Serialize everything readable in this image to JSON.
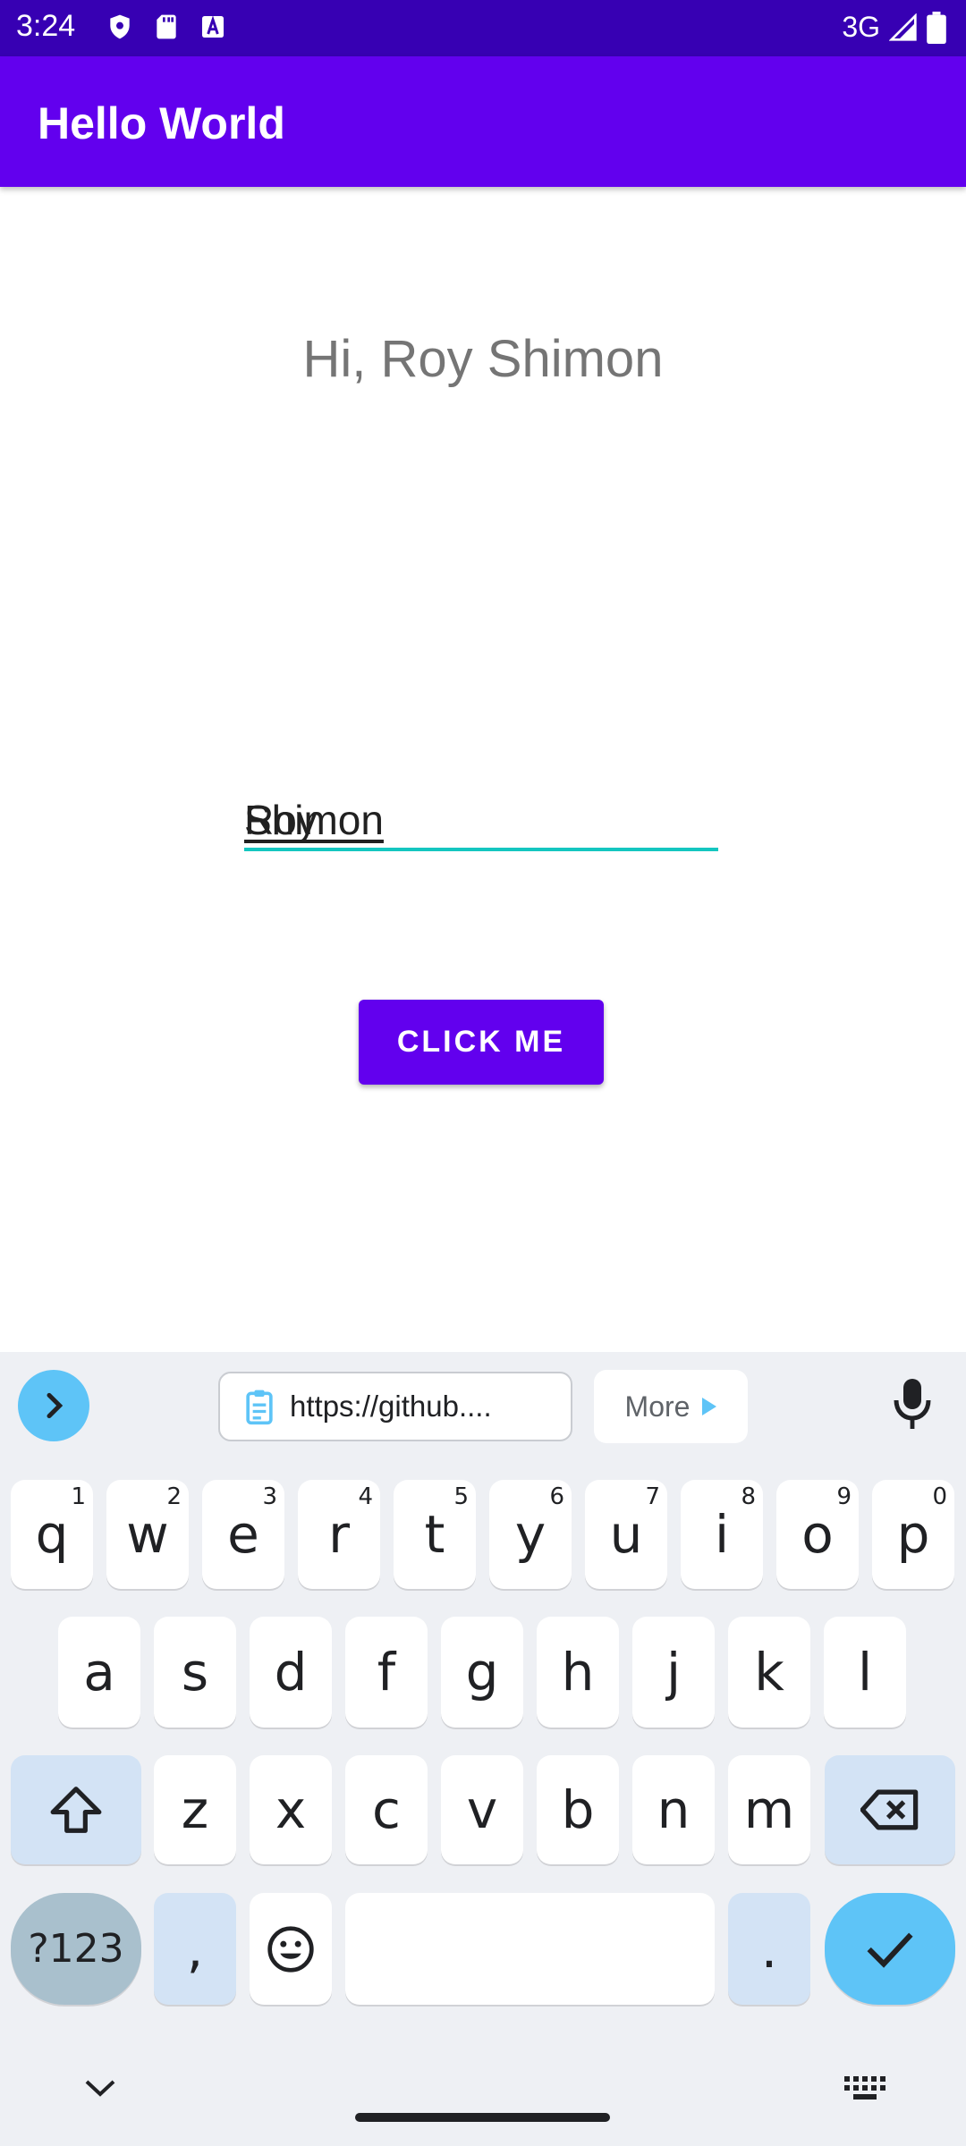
{
  "status_bar": {
    "time": "3:24",
    "network": "3G",
    "icons_left": [
      "shield-icon",
      "sd-card-icon",
      "text-a-icon"
    ],
    "icons_right": [
      "signal-icon",
      "battery-icon"
    ]
  },
  "app_bar": {
    "title": "Hello World"
  },
  "main": {
    "greeting": "Hi, Roy Shimon",
    "name_input": {
      "first": "Roy",
      "second": "Shimon"
    },
    "button_label": "CLICK ME"
  },
  "keyboard": {
    "clipboard_chip": "https://github....",
    "more_chip": "More",
    "row1": [
      {
        "k": "q",
        "n": "1"
      },
      {
        "k": "w",
        "n": "2"
      },
      {
        "k": "e",
        "n": "3"
      },
      {
        "k": "r",
        "n": "4"
      },
      {
        "k": "t",
        "n": "5"
      },
      {
        "k": "y",
        "n": "6"
      },
      {
        "k": "u",
        "n": "7"
      },
      {
        "k": "i",
        "n": "8"
      },
      {
        "k": "o",
        "n": "9"
      },
      {
        "k": "p",
        "n": "0"
      }
    ],
    "row2": [
      "a",
      "s",
      "d",
      "f",
      "g",
      "h",
      "j",
      "k",
      "l"
    ],
    "row3": [
      "z",
      "x",
      "c",
      "v",
      "b",
      "n",
      "m"
    ],
    "symbols_label": "?123",
    "comma": ",",
    "period": "."
  },
  "colors": {
    "status_bar": "#3700b3",
    "primary": "#6200ee",
    "input_underline": "#14c6c0",
    "keyboard_accent": "#5ec4f7"
  }
}
